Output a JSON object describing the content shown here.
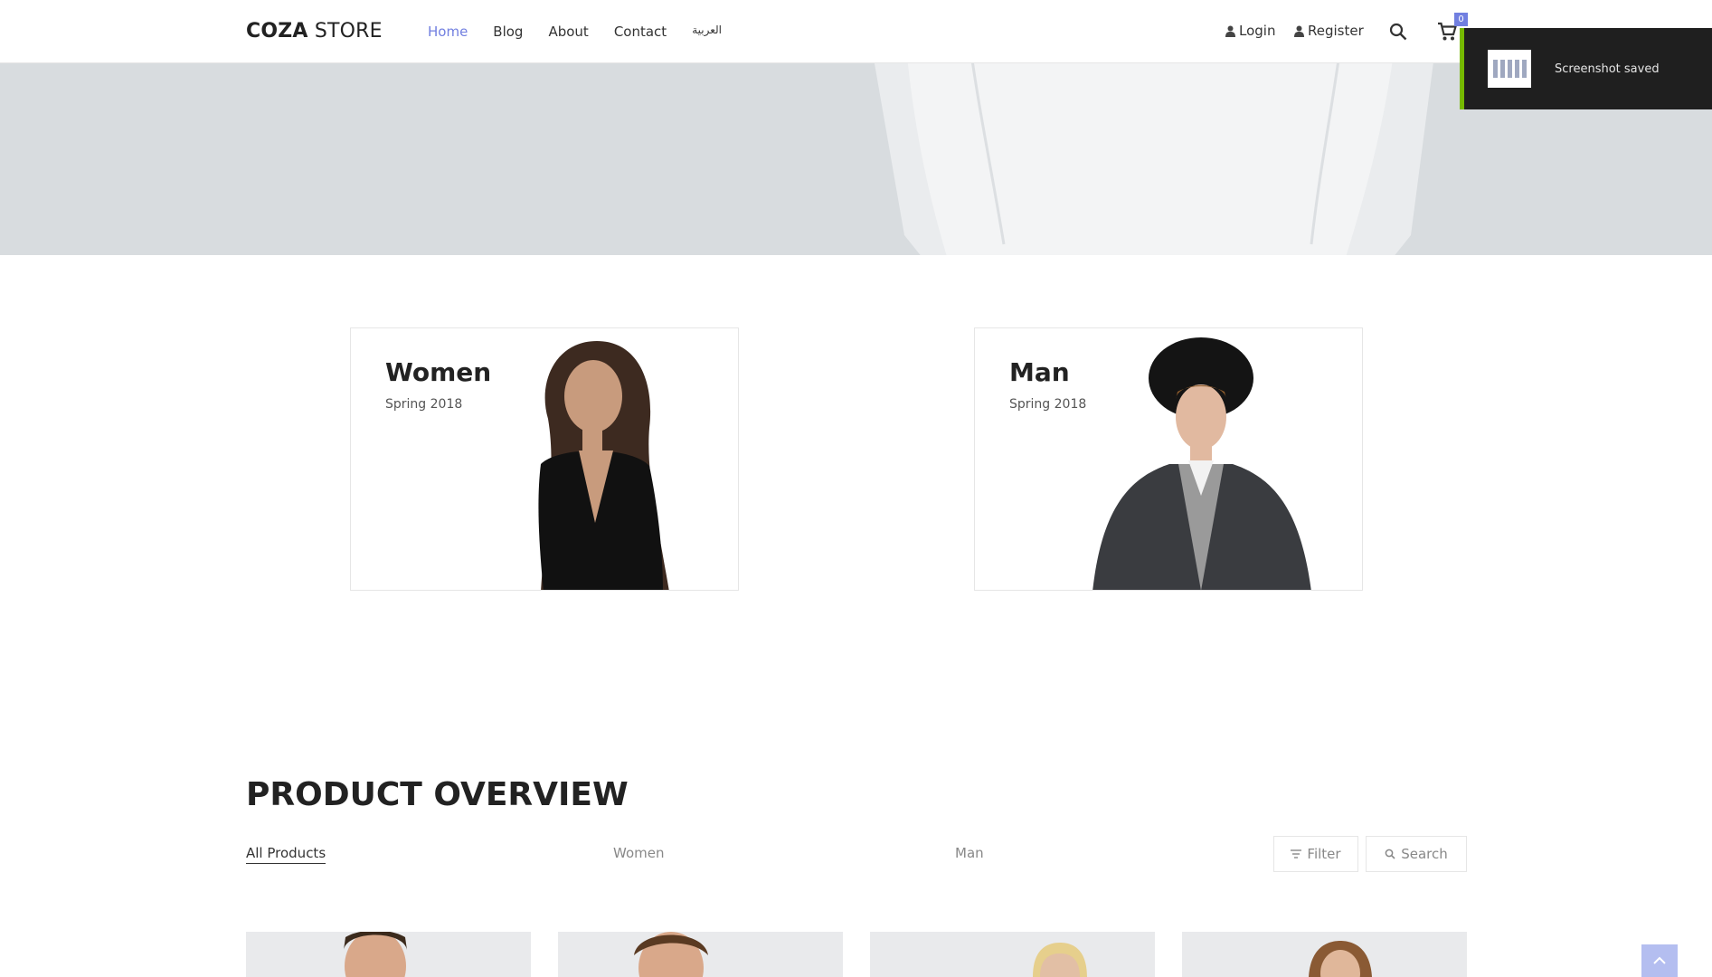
{
  "header": {
    "logo_bold": "COZA",
    "logo_rest": " STORE",
    "nav": [
      "Home",
      "Blog",
      "About",
      "Contact",
      "العربية"
    ],
    "login_label": "Login",
    "register_label": "Register",
    "cart_count": "0"
  },
  "toast": {
    "message": "Screenshot saved"
  },
  "categories": [
    {
      "title": "Women",
      "subtitle": "Spring 2018"
    },
    {
      "title": "Man",
      "subtitle": "Spring 2018"
    }
  ],
  "product_overview": {
    "title": "PRODUCT OVERVIEW",
    "filters": [
      "All Products",
      "Women",
      "Man"
    ],
    "filter_button": "Filter",
    "search_button": "Search"
  },
  "colors": {
    "accent": "#717fe0",
    "hero_bg": "#d8dcdf",
    "toast_accent": "#76b900"
  }
}
